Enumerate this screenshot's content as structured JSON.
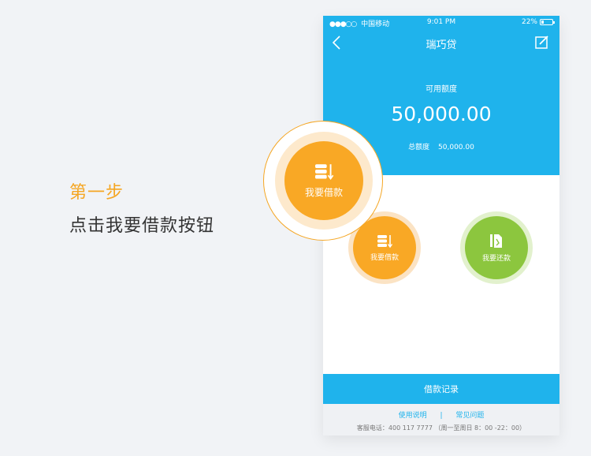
{
  "instruction": {
    "step": "第一步",
    "description": "点击我要借款按钮"
  },
  "status_bar": {
    "signal": "●●●○○",
    "carrier": "中国移动",
    "time": "9:01 PM",
    "battery": "22%"
  },
  "nav": {
    "title": "瑞巧贷"
  },
  "credit": {
    "label": "可用额度",
    "amount": "50,000.00",
    "total_label": "总额度",
    "total_amount": "50,000.00"
  },
  "actions": {
    "borrow_label": "我要借款",
    "repay_label": "我要还款"
  },
  "callout": {
    "label": "我要借款"
  },
  "loan_record": "借款记录",
  "footer": {
    "usage_link": "使用说明",
    "separator": "|",
    "faq_link": "常见问题",
    "hotline": "客服电话：400 117 7777 （周一至周日 8：00 -22：00）"
  },
  "colors": {
    "blue": "#1fb3ec",
    "orange": "#f9a825",
    "green": "#8cc63e",
    "step_orange": "#f5a623"
  },
  "icons": [
    "back-icon",
    "edit-icon",
    "coin-stack-icon",
    "repay-document-icon"
  ]
}
